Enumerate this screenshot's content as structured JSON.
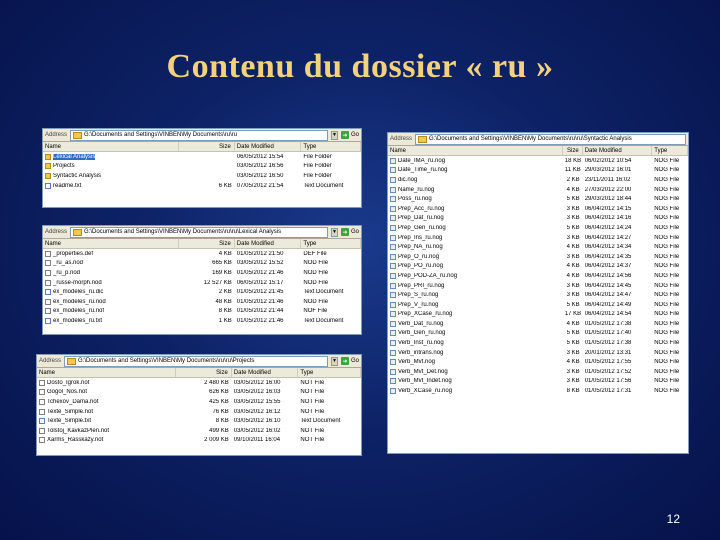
{
  "slide": {
    "title": "Contenu du dossier « ru »",
    "page_number": "12"
  },
  "ui": {
    "address_label": "Address",
    "go_label": "Go",
    "columns": {
      "name": "Name",
      "size": "Size",
      "date": "Date Modified",
      "type": "Type"
    }
  },
  "windows": {
    "ru": {
      "address": "G:\\Documents and Settings\\VINBEN\\My Documents\\ru\\ru",
      "rows": [
        {
          "name": "Lexical Analysis",
          "size": "",
          "date": "06/05/2012 15:54",
          "type": "File Folder",
          "icon": "folder",
          "selected": true
        },
        {
          "name": "Projects",
          "size": "",
          "date": "03/05/2012 16:56",
          "type": "File Folder",
          "icon": "folder"
        },
        {
          "name": "Syntactic Analysis",
          "size": "",
          "date": "03/05/2012 16:50",
          "type": "File Folder",
          "icon": "folder"
        },
        {
          "name": "readme.txt",
          "size": "6 KB",
          "date": "07/05/2012 21:54",
          "type": "Text Document",
          "icon": "txt"
        }
      ]
    },
    "lexical": {
      "address": "G:\\Documents and Settings\\VINBEN\\My Documents\\ru\\ru\\Lexical Analysis",
      "rows": [
        {
          "name": "_properties.def",
          "size": "4 KB",
          "date": "01/05/2012 21:50",
          "type": "DEF File",
          "icon": "file"
        },
        {
          "name": "_ru_as.nod",
          "size": "665 KB",
          "date": "03/05/2012 15:52",
          "type": "NOD File",
          "icon": "file"
        },
        {
          "name": "_ru_p.nod",
          "size": "169 KB",
          "date": "01/05/2012 21:46",
          "type": "NOD File",
          "icon": "file"
        },
        {
          "name": "_russe-morph.nod",
          "size": "12 527 KB",
          "date": "06/05/2012 15:17",
          "type": "NOD File",
          "icon": "file"
        },
        {
          "name": "ex_modeles_ru.dic",
          "size": "2 KB",
          "date": "01/05/2012 21:45",
          "type": "Text Document",
          "icon": "txt"
        },
        {
          "name": "ex_modeles_ru.nod",
          "size": "48 KB",
          "date": "01/05/2012 21:46",
          "type": "NOD File",
          "icon": "file"
        },
        {
          "name": "ex_modeles_ru.nof",
          "size": "8 KB",
          "date": "01/05/2012 21:44",
          "type": "NOF File",
          "icon": "file"
        },
        {
          "name": "ex_modeles_ru.txt",
          "size": "1 KB",
          "date": "01/05/2012 21:46",
          "type": "Text Document",
          "icon": "txt"
        }
      ]
    },
    "projects": {
      "address": "G:\\Documents and Settings\\VINBEN\\My Documents\\ru\\ru\\Projects",
      "rows": [
        {
          "name": "Dosto_Igrok.not",
          "size": "2 480 KB",
          "date": "03/05/2012 16:00",
          "type": "NOT File",
          "icon": "file"
        },
        {
          "name": "Gogol_Nos.not",
          "size": "626 KB",
          "date": "03/05/2012 16:03",
          "type": "NOT File",
          "icon": "file"
        },
        {
          "name": "Tchexov_Dama.not",
          "size": "425 KB",
          "date": "03/05/2012 15:55",
          "type": "NOT File",
          "icon": "file"
        },
        {
          "name": "Texte_Simple.not",
          "size": "76 KB",
          "date": "03/05/2012 16:12",
          "type": "NOT File",
          "icon": "file"
        },
        {
          "name": "Texte_Simple.txt",
          "size": "8 KB",
          "date": "03/05/2012 16:10",
          "type": "Text Document",
          "icon": "txt"
        },
        {
          "name": "Tolstoj_KavkazPlen.not",
          "size": "499 KB",
          "date": "03/05/2012 16:02",
          "type": "NOT File",
          "icon": "file"
        },
        {
          "name": "Xarms_Rasskazy.not",
          "size": "2 009 KB",
          "date": "09/10/2011 16:04",
          "type": "NOT File",
          "icon": "file"
        }
      ]
    },
    "syntactic": {
      "address": "G:\\Documents and Settings\\VINBEN\\My Documents\\ru\\ru\\Syntactic Analysis",
      "rows": [
        {
          "name": "Date_IMA_ru.nog",
          "size": "18 KB",
          "date": "06/02/2012 10:54",
          "type": "NOG File",
          "icon": "nog"
        },
        {
          "name": "Date_Time_ru.nog",
          "size": "11 KB",
          "date": "29/03/2012 16:01",
          "type": "NOG File",
          "icon": "nog"
        },
        {
          "name": "dic.nog",
          "size": "2 KB",
          "date": "23/11/2011 16:02",
          "type": "NOG File",
          "icon": "nog"
        },
        {
          "name": "Name_ru.nog",
          "size": "4 KB",
          "date": "27/03/2012 22:00",
          "type": "NOG File",
          "icon": "nog"
        },
        {
          "name": "Poss_ru.nog",
          "size": "5 KB",
          "date": "29/03/2012 18:44",
          "type": "NOG File",
          "icon": "nog"
        },
        {
          "name": "Prep_Acc_ru.nog",
          "size": "3 KB",
          "date": "06/04/2012 14:15",
          "type": "NOG File",
          "icon": "nog"
        },
        {
          "name": "Prep_Dat_ru.nog",
          "size": "3 KB",
          "date": "06/04/2012 14:16",
          "type": "NOG File",
          "icon": "nog"
        },
        {
          "name": "Prep_Gen_ru.nog",
          "size": "5 KB",
          "date": "06/04/2012 14:24",
          "type": "NOG File",
          "icon": "nog"
        },
        {
          "name": "Prep_Ins_ru.nog",
          "size": "3 KB",
          "date": "06/04/2012 14:27",
          "type": "NOG File",
          "icon": "nog"
        },
        {
          "name": "Prep_NA_ru.nog",
          "size": "4 KB",
          "date": "06/04/2012 14:34",
          "type": "NOG File",
          "icon": "nog"
        },
        {
          "name": "Prep_O_ru.nog",
          "size": "3 KB",
          "date": "06/04/2012 14:35",
          "type": "NOG File",
          "icon": "nog"
        },
        {
          "name": "Prep_PO_ru.nog",
          "size": "4 KB",
          "date": "06/04/2012 14:37",
          "type": "NOG File",
          "icon": "nog"
        },
        {
          "name": "Prep_POD-ZA_ru.nog",
          "size": "4 KB",
          "date": "06/04/2012 14:56",
          "type": "NOG File",
          "icon": "nog"
        },
        {
          "name": "Prep_PRI_ru.nog",
          "size": "3 KB",
          "date": "06/04/2012 14:45",
          "type": "NOG File",
          "icon": "nog"
        },
        {
          "name": "Prep_S_ru.nog",
          "size": "3 KB",
          "date": "06/04/2012 14:47",
          "type": "NOG File",
          "icon": "nog"
        },
        {
          "name": "Prep_V_ru.nog",
          "size": "5 KB",
          "date": "06/04/2012 14:49",
          "type": "NOG File",
          "icon": "nog"
        },
        {
          "name": "Prep_XCase_ru.nog",
          "size": "17 KB",
          "date": "06/04/2012 14:54",
          "type": "NOG File",
          "icon": "nog"
        },
        {
          "name": "Verb_Dat_ru.nog",
          "size": "4 KB",
          "date": "01/05/2012 17:38",
          "type": "NOG File",
          "icon": "nog"
        },
        {
          "name": "Verb_Gen_ru.nog",
          "size": "5 KB",
          "date": "01/05/2012 17:40",
          "type": "NOG File",
          "icon": "nog"
        },
        {
          "name": "Verb_Inst_ru.nog",
          "size": "5 KB",
          "date": "01/05/2012 17:38",
          "type": "NOG File",
          "icon": "nog"
        },
        {
          "name": "Verb_intrans.nog",
          "size": "3 KB",
          "date": "20/01/2012 13:31",
          "type": "NOG File",
          "icon": "nog"
        },
        {
          "name": "Verb_Mvt.nog",
          "size": "4 KB",
          "date": "01/05/2012 17:55",
          "type": "NOG File",
          "icon": "nog"
        },
        {
          "name": "Verb_Mvt_Det.nog",
          "size": "3 KB",
          "date": "01/05/2012 17:52",
          "type": "NOG File",
          "icon": "nog"
        },
        {
          "name": "Verb_Mvt_Indet.nog",
          "size": "3 KB",
          "date": "01/05/2012 17:56",
          "type": "NOG File",
          "icon": "nog"
        },
        {
          "name": "Verb_XCase_ru.nog",
          "size": "8 KB",
          "date": "01/05/2012 17:31",
          "type": "NOG File",
          "icon": "nog"
        }
      ]
    }
  }
}
